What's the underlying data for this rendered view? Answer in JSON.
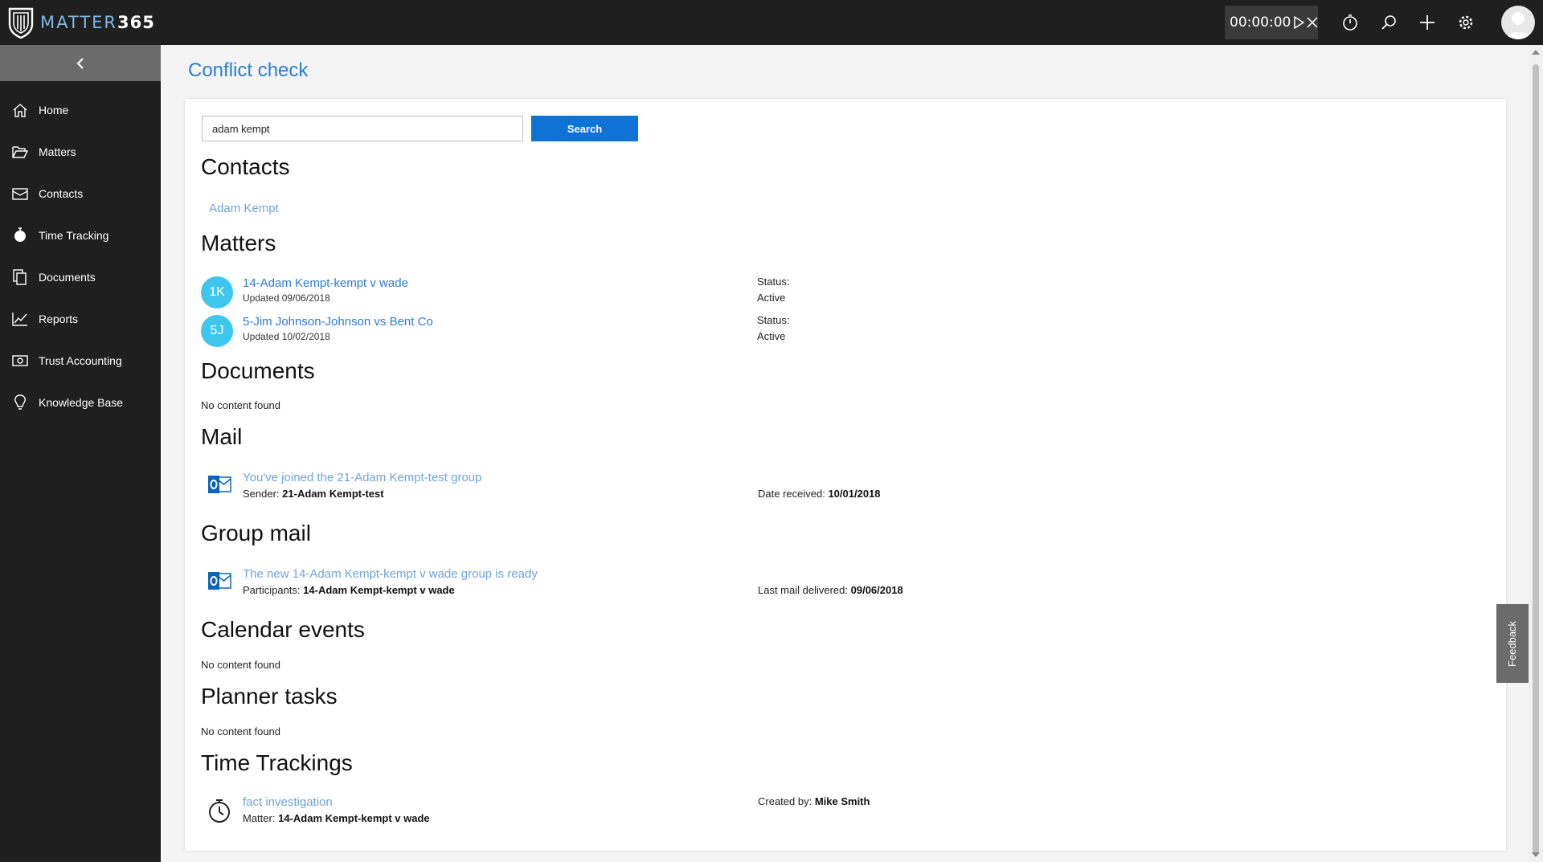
{
  "app": {
    "brand": "MATTER",
    "brand_num": "365"
  },
  "timer": {
    "value": "00:00:00"
  },
  "sidebar": {
    "items": [
      {
        "label": "Home",
        "icon": "home-icon"
      },
      {
        "label": "Matters",
        "icon": "folder-open-icon"
      },
      {
        "label": "Contacts",
        "icon": "contact-card-icon"
      },
      {
        "label": "Time Tracking",
        "icon": "stopwatch-icon"
      },
      {
        "label": "Documents",
        "icon": "documents-icon"
      },
      {
        "label": "Reports",
        "icon": "chart-line-icon"
      },
      {
        "label": "Trust Accounting",
        "icon": "money-icon"
      },
      {
        "label": "Knowledge Base",
        "icon": "lightbulb-icon"
      }
    ]
  },
  "page": {
    "title": "Conflict check"
  },
  "search": {
    "value": "adam kempt",
    "button": "Search"
  },
  "sections": {
    "contacts": {
      "title": "Contacts",
      "items": [
        "Adam Kempt"
      ]
    },
    "matters": {
      "title": "Matters",
      "items": [
        {
          "initials": "1K",
          "name": "14-Adam Kempt-kempt v wade",
          "updated": "Updated 09/06/2018",
          "status_label": "Status:",
          "status": "Active"
        },
        {
          "initials": "5J",
          "name": "5-Jim Johnson-Johnson vs Bent Co",
          "updated": "Updated 10/02/2018",
          "status_label": "Status:",
          "status": "Active"
        }
      ]
    },
    "documents": {
      "title": "Documents",
      "empty": "No content found"
    },
    "mail": {
      "title": "Mail",
      "subject": "You've joined the 21-Adam Kempt-test group",
      "sender_label": "Sender:",
      "sender": "21-Adam Kempt-test",
      "date_label": "Date received:",
      "date": "10/01/2018"
    },
    "group_mail": {
      "title": "Group mail",
      "subject": "The new 14-Adam Kempt-kempt v wade group is ready",
      "participants_label": "Participants:",
      "participants": "14-Adam Kempt-kempt v wade",
      "date_label": "Last mail delivered:",
      "date": "09/06/2018"
    },
    "calendar": {
      "title": "Calendar events",
      "empty": "No content found"
    },
    "planner": {
      "title": "Planner tasks",
      "empty": "No content found"
    },
    "time_trackings": {
      "title": "Time Trackings",
      "entry": "fact investigation",
      "matter_label": "Matter:",
      "matter": "14-Adam Kempt-kempt v wade",
      "created_label": "Created by:",
      "created_by": "Mike Smith"
    }
  },
  "feedback": {
    "label": "Feedback"
  },
  "colors": {
    "accent": "#0f73d6",
    "link": "#2b7cd3",
    "bubble": "#3dc7ee",
    "topbar": "#1f1f1f"
  }
}
